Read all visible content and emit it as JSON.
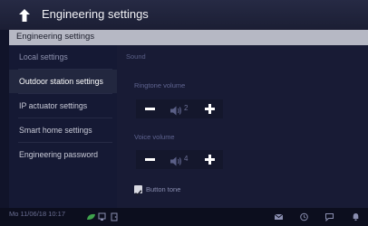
{
  "header": {
    "title": "Engineering settings",
    "back_icon": "back-arrow-icon"
  },
  "breadcrumb": {
    "text": "Engineering settings"
  },
  "sidebar": {
    "items": [
      {
        "label": "Local settings",
        "state": "dim"
      },
      {
        "label": "Outdoor station settings",
        "state": "active"
      },
      {
        "label": "IP actuator settings",
        "state": "normal"
      },
      {
        "label": "Smart home settings",
        "state": "normal"
      },
      {
        "label": "Engineering password",
        "state": "normal"
      }
    ]
  },
  "content": {
    "section_title": "Sound",
    "ringtone": {
      "label": "Ringtone volume",
      "value": "2"
    },
    "voice": {
      "label": "Voice volume",
      "value": "4"
    },
    "button_tone": {
      "label": "Button tone",
      "checked": true
    }
  },
  "status_bar": {
    "datetime": "Mo 11/06/18  10:17",
    "left_icons": [
      "leaf-icon",
      "network-icon",
      "door-icon"
    ],
    "right_icons": [
      "mail-icon",
      "clock-icon",
      "chat-icon",
      "bell-icon"
    ]
  },
  "colors": {
    "accent_green": "#3fa34d",
    "breadcrumb_bg": "#b6b8c4",
    "sidebar_bg": "#151934",
    "content_bg": "#181b35"
  }
}
